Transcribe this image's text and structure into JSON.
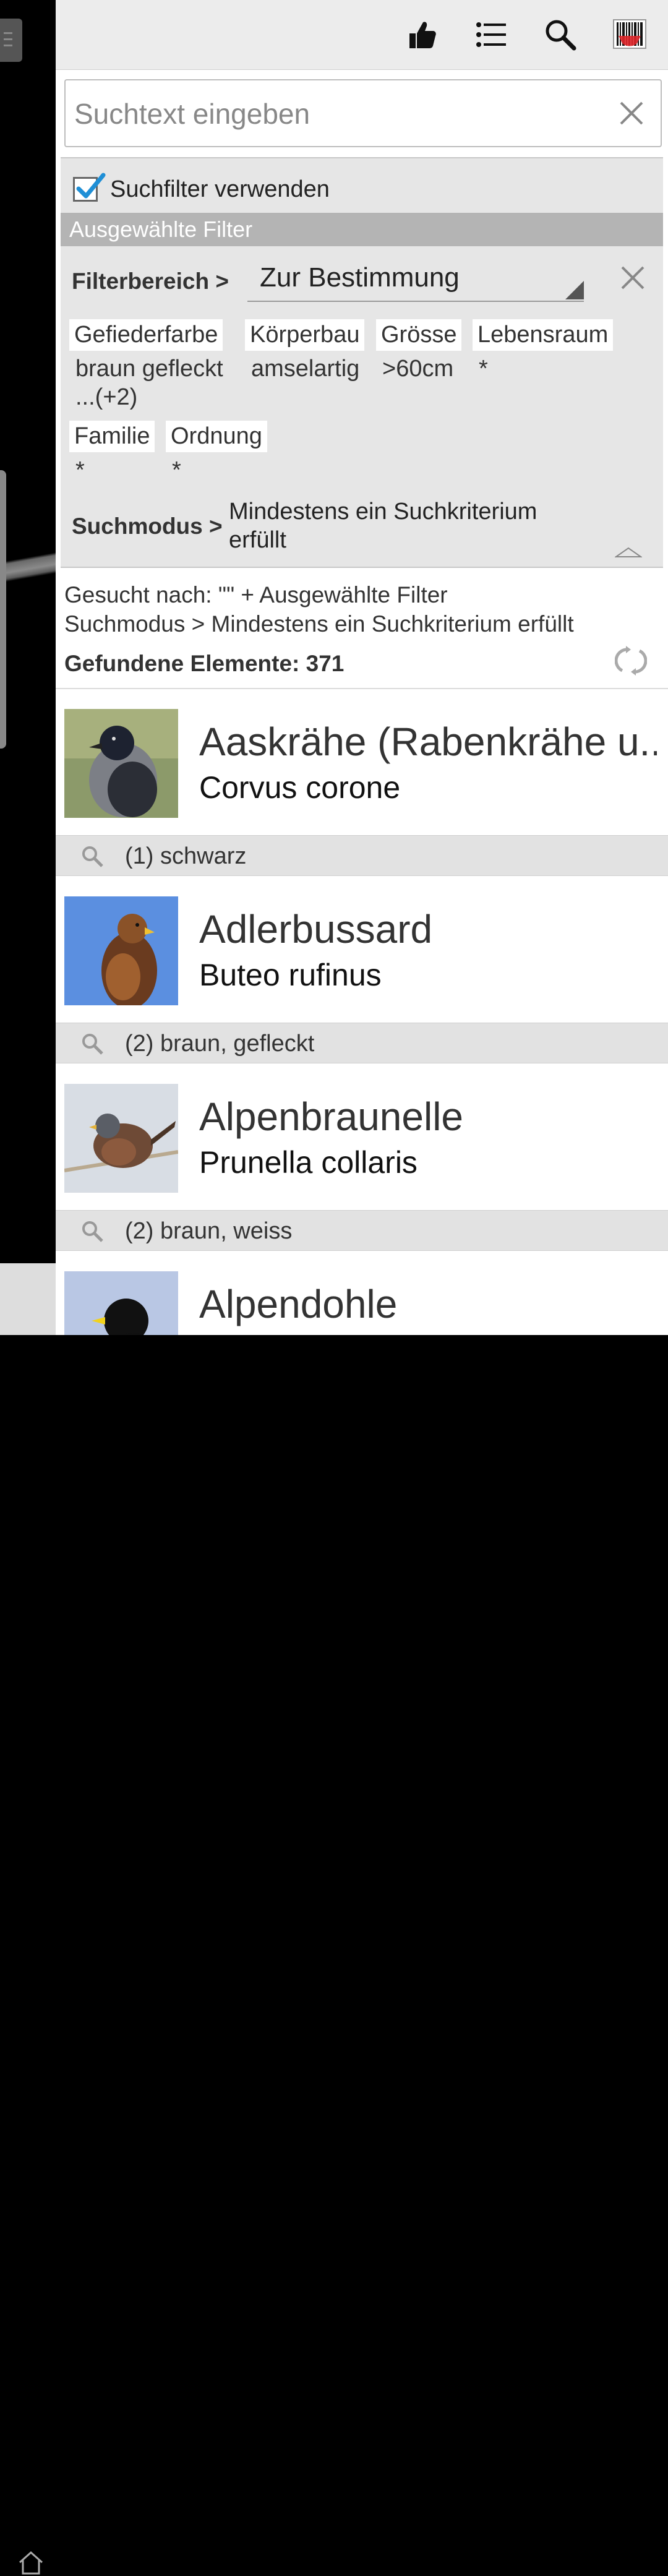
{
  "toolbar": {
    "like_icon": "thumbs-up-icon",
    "list_icon": "list-icon",
    "search_icon": "search-icon",
    "barcode_icon": "barcode-scanner-icon"
  },
  "search": {
    "placeholder": "Suchtext eingeben",
    "value": ""
  },
  "filter": {
    "use_filter_label": "Suchfilter verwenden",
    "use_filter_checked": true,
    "selected_header": "Ausgewählte Filter",
    "area_label": "Filterbereich >",
    "area_value": "Zur Bestimmung",
    "chips": [
      {
        "label": "Gefiederfarbe",
        "value": "braun gefleckt ...(+2)"
      },
      {
        "label": "Körperbau",
        "value": "amselartig"
      },
      {
        "label": "Grösse",
        "value": ">60cm"
      },
      {
        "label": "Lebensraum",
        "value": "*"
      },
      {
        "label": "Familie",
        "value": "*"
      },
      {
        "label": "Ordnung",
        "value": "*"
      }
    ],
    "mode_label": "Suchmodus >",
    "mode_value": "Mindestens ein Suchkriterium erfüllt"
  },
  "summary": {
    "searched_for": "Gesucht nach:  \"\" + Ausgewählte Filter",
    "mode_line": "Suchmodus > Mindestens ein Suchkriterium erfüllt",
    "found": "Gefundene Elemente: 371"
  },
  "results": [
    {
      "name": "Aaskrähe (Rabenkrähe u..",
      "latin": "Corvus corone",
      "match": "(1) schwarz"
    },
    {
      "name": "Adlerbussard",
      "latin": "Buteo rufinus",
      "match": "(2) braun, gefleckt"
    },
    {
      "name": "Alpenbraunelle",
      "latin": "Prunella collaris",
      "match": "(2) braun, weiss"
    },
    {
      "name": "Alpendohle",
      "latin": "",
      "match": ""
    }
  ],
  "colors": {
    "accent_check": "#1f8fd6",
    "barcode_red": "#e0262a",
    "filter_header_bg": "#b4b4b4"
  }
}
